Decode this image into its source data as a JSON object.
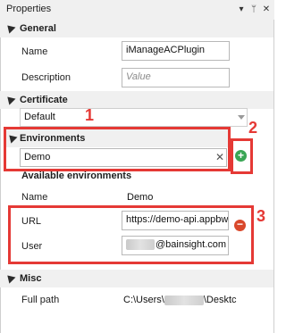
{
  "window": {
    "title": "Properties",
    "controls": {
      "dropdown": "▾",
      "pin": "ᛘ",
      "close": "✕"
    }
  },
  "sections": {
    "general": {
      "title": "General",
      "name_label": "Name",
      "name_value": "iManageACPlugin",
      "description_label": "Description",
      "description_placeholder": "Value"
    },
    "certificate": {
      "title": "Certificate",
      "selected": "Default"
    },
    "environments": {
      "title": "Environments",
      "filter_value": "Demo",
      "clear_glyph": "✕",
      "available_title": "Available environments",
      "name_label": "Name",
      "name_value": "Demo",
      "url_label": "URL",
      "url_value": "https://demo-api.appbw",
      "user_label": "User",
      "user_value": "@bainsight.com"
    },
    "misc": {
      "title": "Misc",
      "fullpath_label": "Full path",
      "fullpath_prefix": "C:\\Users\\",
      "fullpath_suffix": "\\Desktc"
    }
  },
  "callouts": {
    "one": "1",
    "two": "2",
    "three": "3"
  },
  "colors": {
    "annotation": "#e53935",
    "add": "#3aa655",
    "remove": "#d9482b",
    "header_bg": "#f0f0f0"
  },
  "icons": {
    "add": "plus-circle-icon",
    "remove": "minus-circle-icon",
    "collapse": "collapse-triangle-icon"
  }
}
